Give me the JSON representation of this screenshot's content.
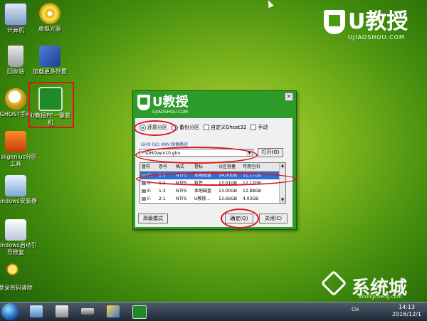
{
  "desktop": {
    "icons": [
      {
        "label": "计算机",
        "icon": "computer-icon"
      },
      {
        "label": "虚拟光驱",
        "icon": "virtual-drive-icon"
      },
      {
        "label": "回收站",
        "icon": "recycle-bin-icon"
      },
      {
        "label": "加载更多外置",
        "icon": "load-tools-icon"
      },
      {
        "label": "GHOST手动",
        "icon": "ghost-icon"
      },
      {
        "label": "U教授PE一键装机",
        "icon": "pe-installer-icon"
      },
      {
        "label": "Diskgenius分区工具",
        "icon": "diskgenius-icon"
      },
      {
        "label": "Windows安装器",
        "icon": "windows-installer-icon"
      },
      {
        "label": "Windows启动引导修复",
        "icon": "boot-repair-icon"
      },
      {
        "label": "登录密码清除",
        "icon": "password-clear-icon"
      }
    ]
  },
  "brand": {
    "title": "U教授",
    "subtitle": "UJIAOSHOU.COM"
  },
  "dialog": {
    "logo_title": "U教授",
    "logo_sub": "UJIAOSHOU.COM",
    "close_label": "×",
    "options": {
      "restore": "还原分区",
      "backup": "备份分区",
      "custom_ghost": "自定义Ghost32",
      "manual": "手动"
    },
    "path_label": "GHO ISO WIN 映像路径",
    "path_value": "F:\\GHO\\win10.gho",
    "open_button": "打开(O)",
    "table": {
      "headers": [
        "盘符",
        "卷号",
        "格式",
        "卷标",
        "分区容量",
        "可用空间"
      ],
      "rows": [
        {
          "cells": [
            "C:",
            "1:1",
            "NTFS",
            "本地磁盘",
            "14.00GB",
            "11.27GB"
          ],
          "selected": true
        },
        {
          "cells": [
            "D:",
            "1:2",
            "NTFS",
            "软件",
            "13.01GB",
            "12.17GB"
          ],
          "selected": false
        },
        {
          "cells": [
            "E:",
            "1:3",
            "NTFS",
            "本地磁盘",
            "13.00GB",
            "12.88GB"
          ],
          "selected": false
        },
        {
          "cells": [
            "F:",
            "2:1",
            "NTFS",
            "U教授...",
            "13.66GB",
            "4.03GB"
          ],
          "selected": false
        }
      ]
    },
    "advanced_button": "高级模式",
    "ok_button": "确定(Q)",
    "close_button": "关闭(C)"
  },
  "taskbar": {
    "lang": "CH",
    "clock_time": "14:13",
    "clock_date": "2016/12/1"
  },
  "watermark": {
    "text": "系统城",
    "site": "xitongcheng.com"
  },
  "colors": {
    "highlight": "#d8181c",
    "dialog_green": "#2c9b2a",
    "selection": "#2f6fd1"
  }
}
